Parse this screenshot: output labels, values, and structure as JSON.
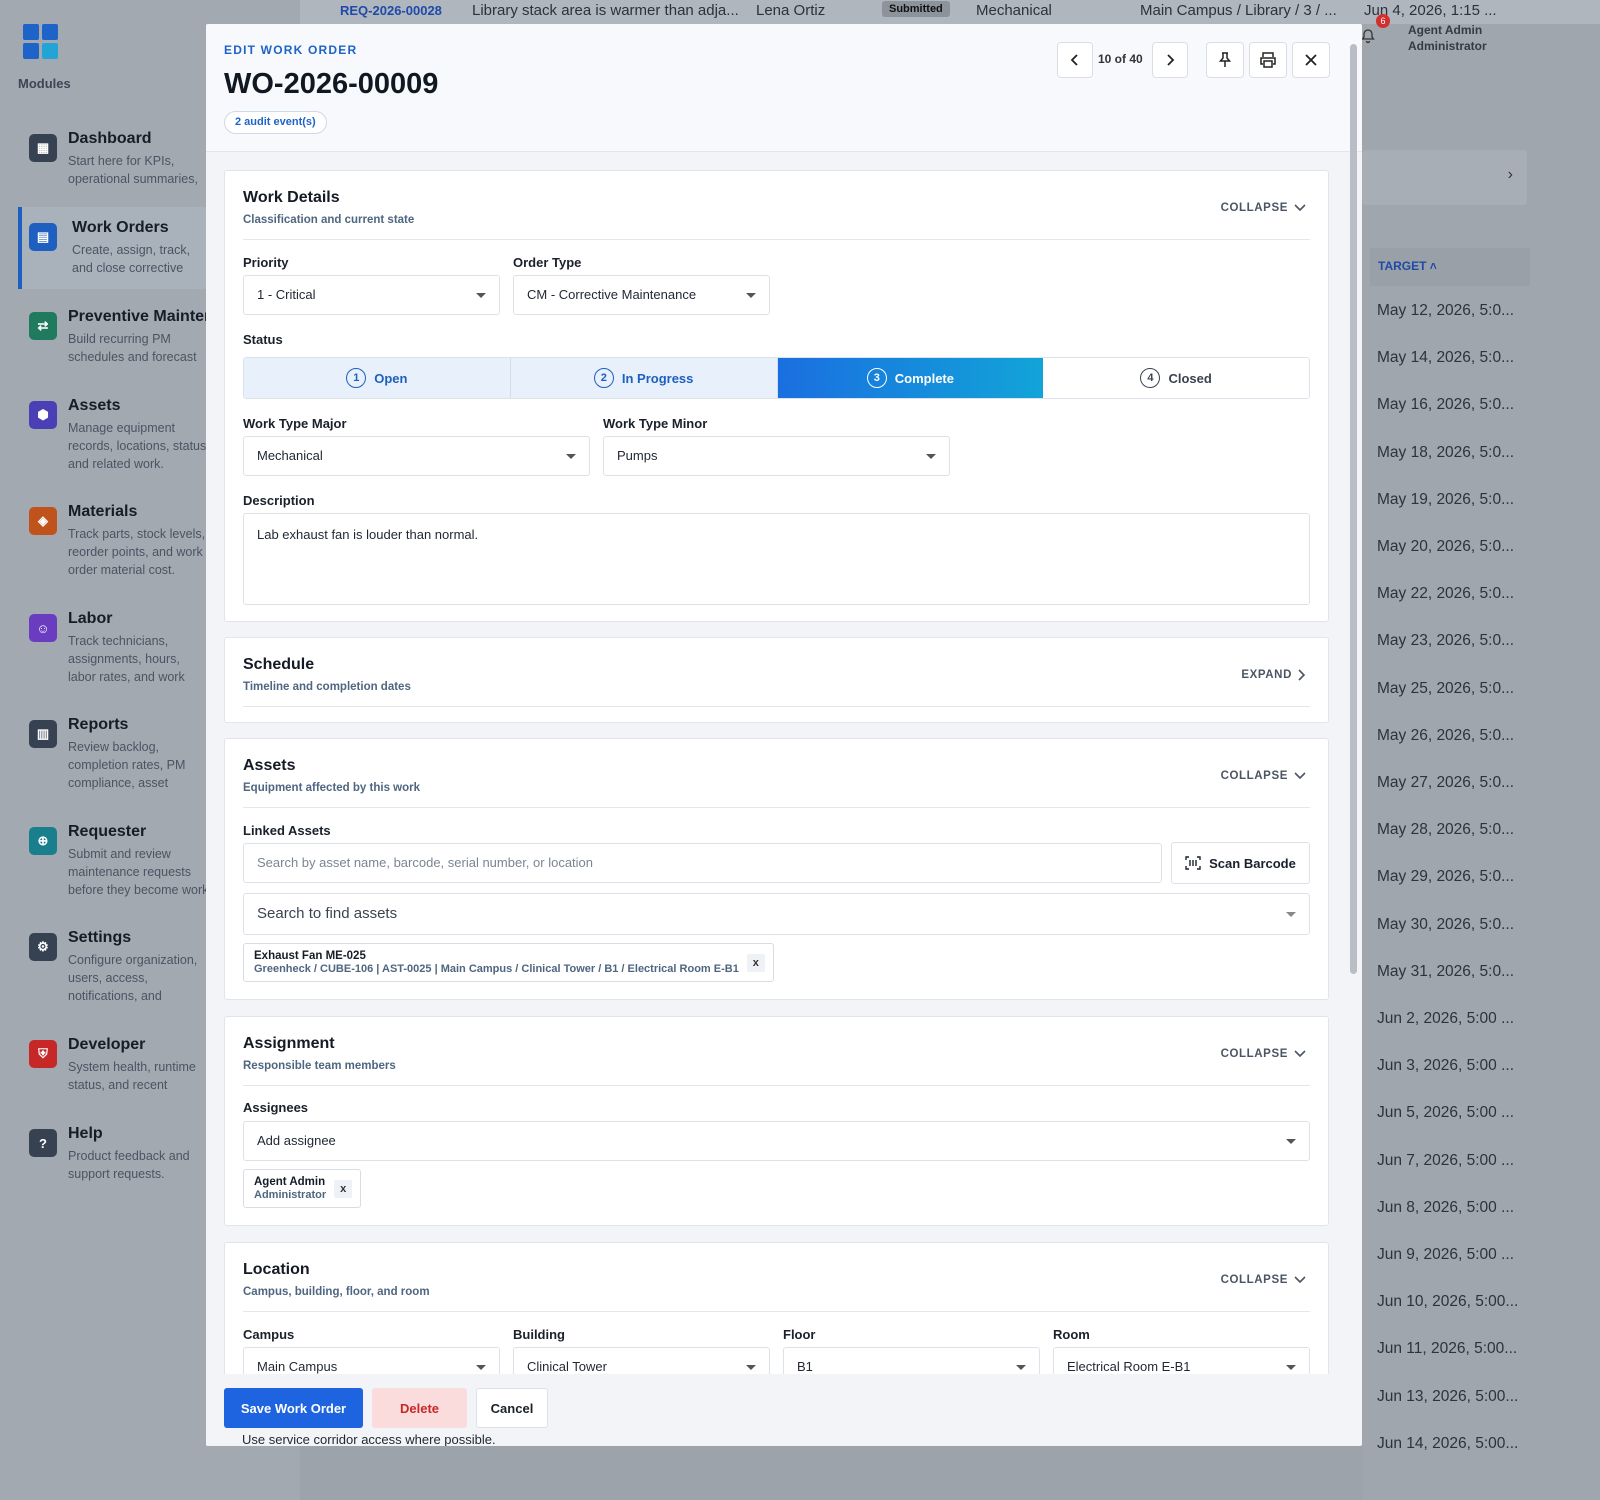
{
  "sidebar": {
    "modules_label": "Modules",
    "items": [
      {
        "title": "Dashboard",
        "desc": "Start here for KPIs, operational summaries, and FIA insights."
      },
      {
        "title": "Work Orders",
        "desc": "Create, assign, track, and close corrective maintenance work."
      },
      {
        "title": "Preventive Maintenance",
        "desc": "Build recurring PM schedules and forecast upcoming work."
      },
      {
        "title": "Assets",
        "desc": "Manage equipment records, locations, status, and related work."
      },
      {
        "title": "Materials",
        "desc": "Track parts, stock levels, reorder points, and work order material cost."
      },
      {
        "title": "Labor",
        "desc": "Track technicians, assignments, hours, labor rates, and work cost."
      },
      {
        "title": "Reports",
        "desc": "Review backlog, completion rates, PM compliance, asset activity, and cost trends."
      },
      {
        "title": "Requester",
        "desc": "Submit and review maintenance requests before they become work orders."
      },
      {
        "title": "Settings",
        "desc": "Configure organization, users, access, notifications, and appearance."
      },
      {
        "title": "Developer",
        "desc": "System health, runtime status, and recent platform activity."
      },
      {
        "title": "Help",
        "desc": "Product feedback and support requests."
      }
    ]
  },
  "topbar": {
    "req_id": "REQ-2026-00028",
    "description": "Library stack area is warmer than adja...",
    "requester": "Lena Ortiz",
    "status": "Submitted",
    "type": "Mechanical",
    "location": "Main Campus / Library / 3 / ...",
    "date": "Jun 4, 2026, 1:15 ..."
  },
  "user": {
    "name": "Agent Admin",
    "role": "Administrator",
    "notification_count": "6"
  },
  "background_list": {
    "target_header": "TARGET",
    "targets": [
      "May 12, 2026, 5:0...",
      "May 14, 2026, 5:0...",
      "May 16, 2026, 5:0...",
      "May 18, 2026, 5:0...",
      "May 19, 2026, 5:0...",
      "May 20, 2026, 5:0...",
      "May 22, 2026, 5:0...",
      "May 23, 2026, 5:0...",
      "May 25, 2026, 5:0...",
      "May 26, 2026, 5:0...",
      "May 27, 2026, 5:0...",
      "May 28, 2026, 5:0...",
      "May 29, 2026, 5:0...",
      "May 30, 2026, 5:0...",
      "May 31, 2026, 5:0...",
      "Jun 2, 2026, 5:00 ...",
      "Jun 3, 2026, 5:00 ...",
      "Jun 5, 2026, 5:00 ...",
      "Jun 7, 2026, 5:00 ...",
      "Jun 8, 2026, 5:00 ...",
      "Jun 9, 2026, 5:00 ...",
      "Jun 10, 2026, 5:00...",
      "Jun 11, 2026, 5:00...",
      "Jun 13, 2026, 5:00...",
      "Jun 14, 2026, 5:00..."
    ]
  },
  "modal": {
    "eyebrow": "EDIT WORK ORDER",
    "title": "WO-2026-00009",
    "audit_badge": "2 audit event(s)",
    "pager": "10 of 40"
  },
  "work_details": {
    "title": "Work Details",
    "subtitle": "Classification and current state",
    "toggle": "COLLAPSE",
    "priority_label": "Priority",
    "priority_value": "1 - Critical",
    "order_type_label": "Order Type",
    "order_type_value": "CM - Corrective Maintenance",
    "status_label": "Status",
    "status_steps": [
      {
        "num": "1",
        "label": "Open"
      },
      {
        "num": "2",
        "label": "In Progress"
      },
      {
        "num": "3",
        "label": "Complete"
      },
      {
        "num": "4",
        "label": "Closed"
      }
    ],
    "wt_major_label": "Work Type Major",
    "wt_major_value": "Mechanical",
    "wt_minor_label": "Work Type Minor",
    "wt_minor_value": "Pumps",
    "description_label": "Description",
    "description_value": "Lab exhaust fan is louder than normal."
  },
  "schedule": {
    "title": "Schedule",
    "subtitle": "Timeline and completion dates",
    "toggle": "EXPAND"
  },
  "assets": {
    "title": "Assets",
    "subtitle": "Equipment affected by this work",
    "toggle": "COLLAPSE",
    "linked_label": "Linked Assets",
    "search_placeholder": "Search by asset name, barcode, serial number, or location",
    "scan_label": "Scan Barcode",
    "find_placeholder": "Search to find assets",
    "chip_name": "Exhaust Fan ME-025",
    "chip_detail": "Greenheck / CUBE-106 | AST-0025 | Main Campus / Clinical Tower / B1 / Electrical Room E-B1",
    "chip_remove": "x"
  },
  "assignment": {
    "title": "Assignment",
    "subtitle": "Responsible team members",
    "toggle": "COLLAPSE",
    "assignees_label": "Assignees",
    "add_placeholder": "Add assignee",
    "chip_name": "Agent Admin",
    "chip_role": "Administrator",
    "chip_remove": "x"
  },
  "location": {
    "title": "Location",
    "subtitle": "Campus, building, floor, and room",
    "toggle": "COLLAPSE",
    "campus_label": "Campus",
    "campus_value": "Main Campus",
    "building_label": "Building",
    "building_value": "Clinical Tower",
    "floor_label": "Floor",
    "floor_value": "B1",
    "room_label": "Room",
    "room_value": "Electrical Room E-B1"
  },
  "footer": {
    "save": "Save Work Order",
    "delete": "Delete",
    "cancel": "Cancel",
    "overflow_text": "Use service corridor access where possible."
  },
  "colors": {
    "accent": "#1E63C8",
    "status_active": "#1A6FE0",
    "delete_bg": "#FCE1E1",
    "delete_text": "#C62828"
  }
}
